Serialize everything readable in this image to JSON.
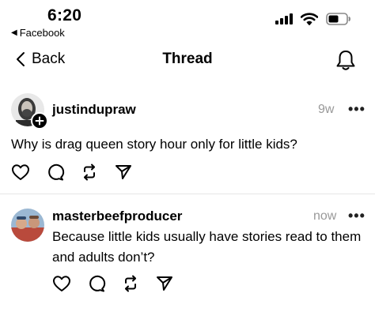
{
  "status_bar": {
    "time": "6:20",
    "back_app": "Facebook"
  },
  "nav": {
    "back_label": "Back",
    "title": "Thread"
  },
  "posts": [
    {
      "username": "justindupraw",
      "timestamp": "9w",
      "more": "•••",
      "text": "Why is drag queen story hour only for little kids?"
    },
    {
      "username": "masterbeefproducer",
      "timestamp": "now",
      "more": "•••",
      "text": "Because little kids usually have stories read to them and adults don’t?"
    }
  ],
  "icons": {
    "signal": "signal-icon",
    "wifi": "wifi-icon",
    "battery": "battery-icon",
    "bell": "bell-icon",
    "like": "heart-icon",
    "reply": "comment-icon",
    "repost": "repost-icon",
    "share": "send-icon"
  }
}
